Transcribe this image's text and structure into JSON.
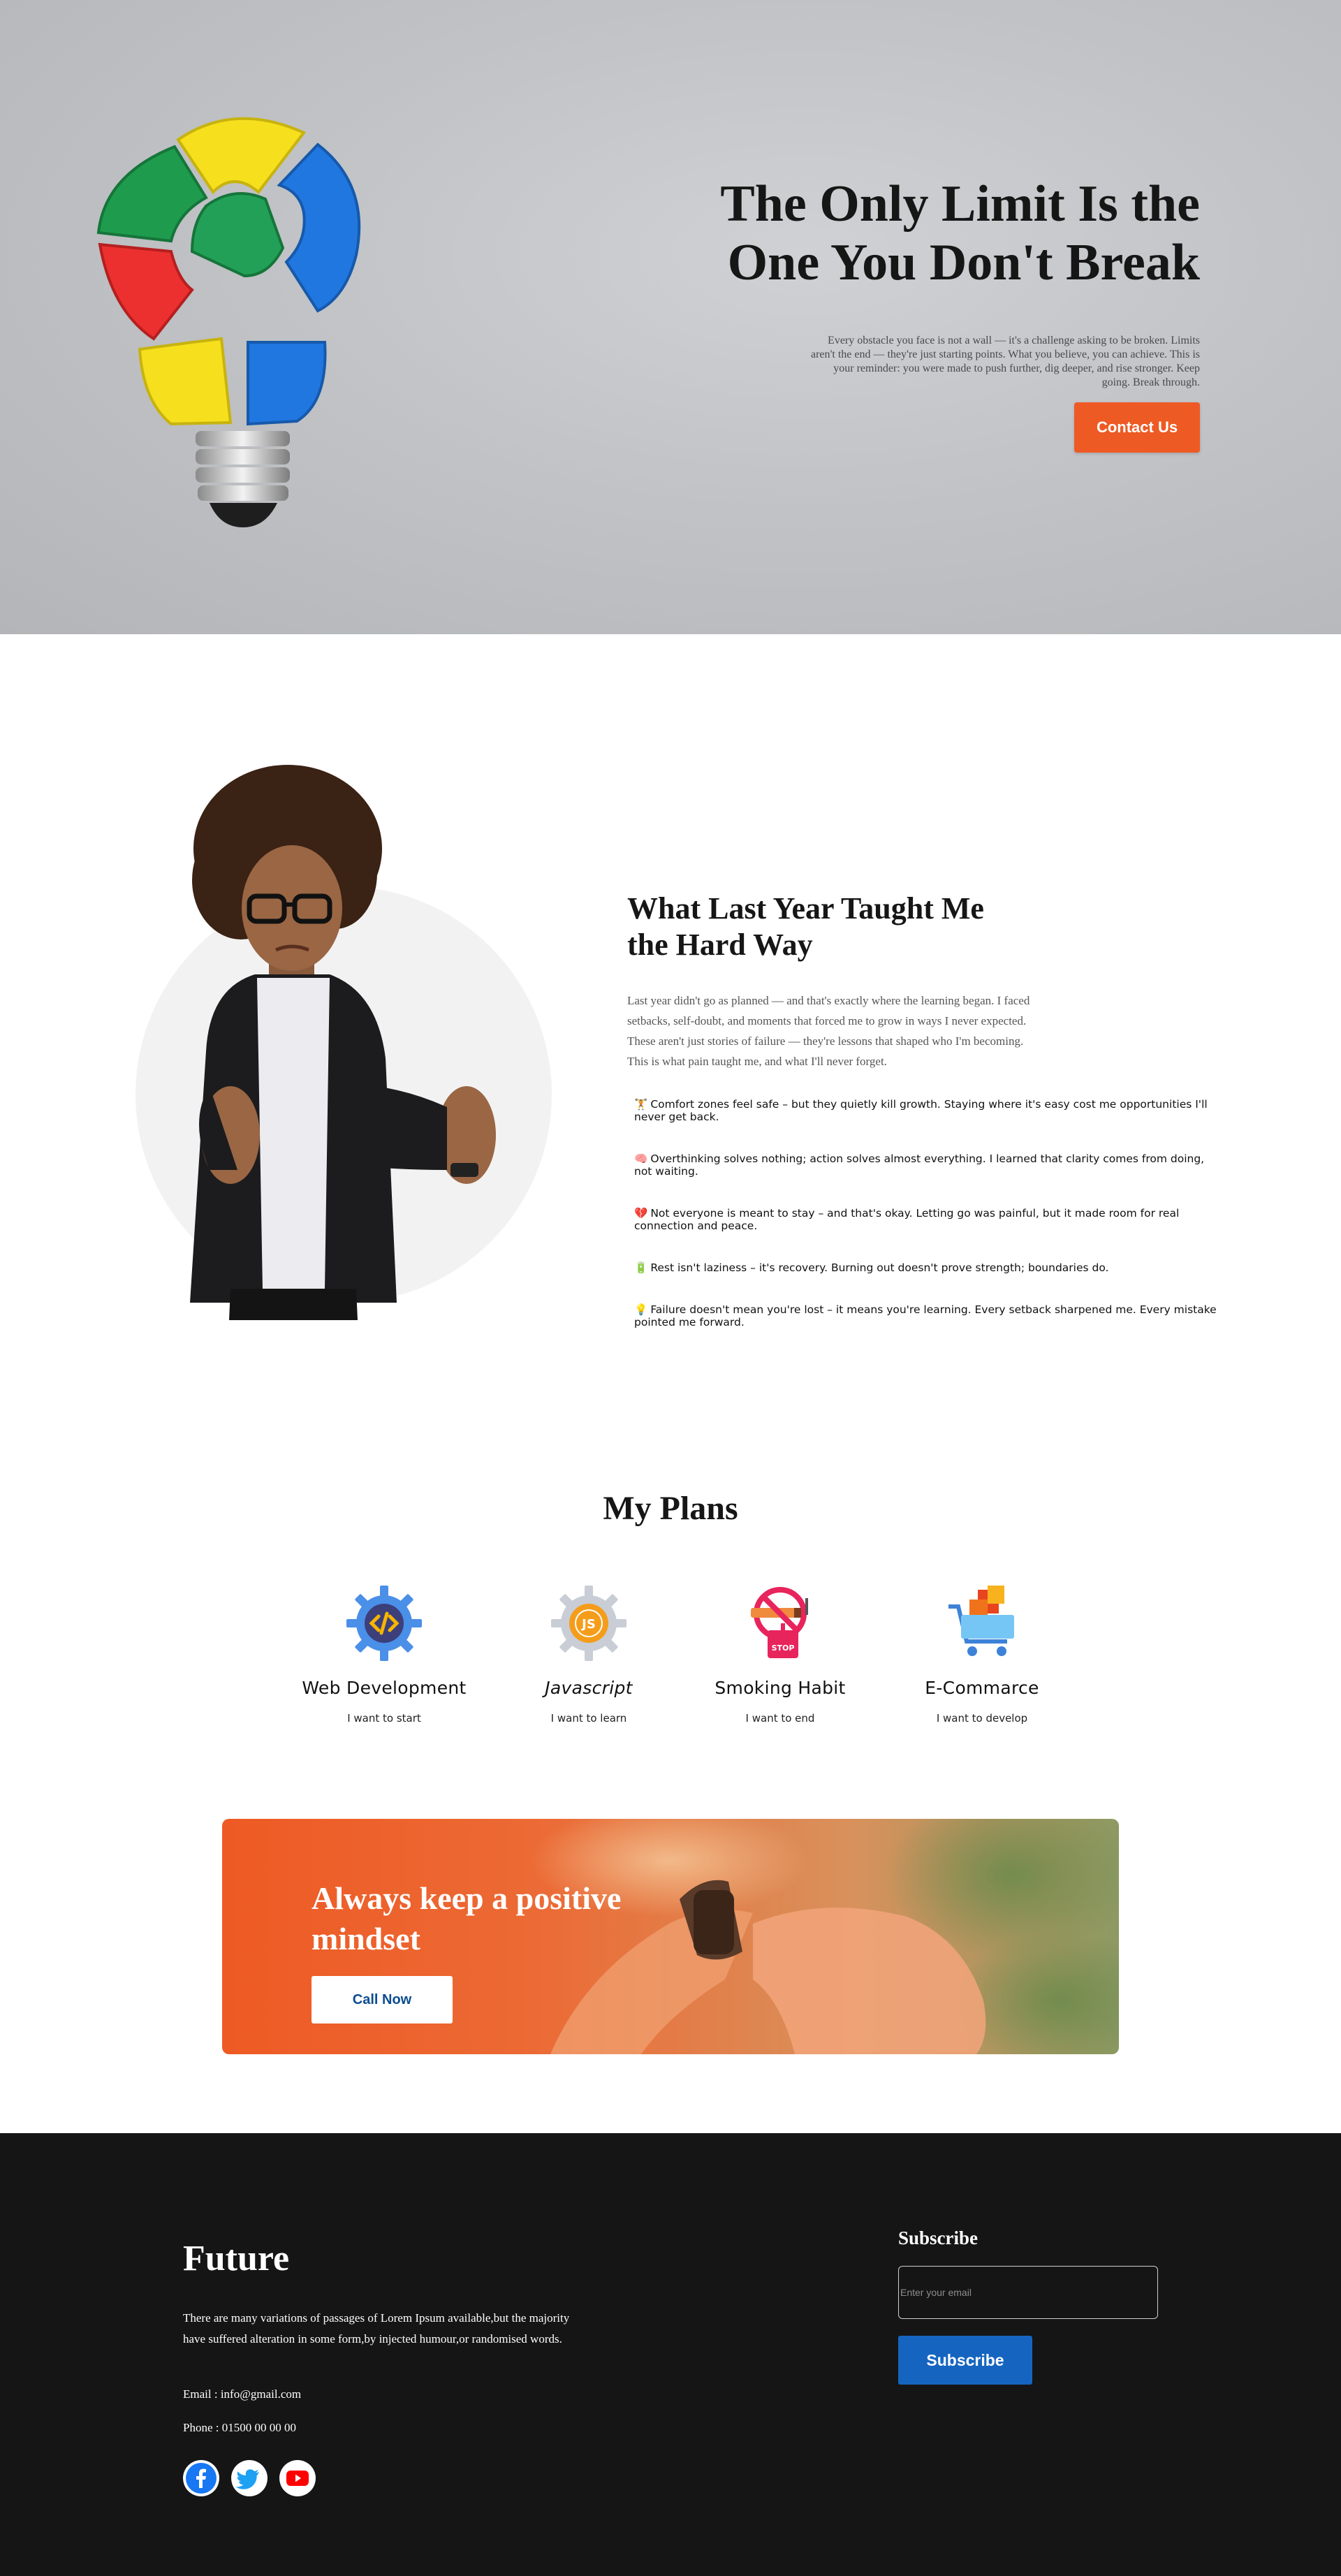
{
  "hero": {
    "title": "The Only Limit Is the One You Don't Break",
    "description": "Every obstacle you face is not a wall — it's a challenge asking to be broken. Limits aren't the end — they're just starting points. What you believe, you can achieve. This is your reminder: you were made to push further, dig deeper, and rise stronger. Keep going. Break through.",
    "contact_label": "Contact Us",
    "accent_color": "#ee5a24"
  },
  "lessons": {
    "title": "What Last Year Taught Me the Hard Way",
    "intro": "Last year didn't go as planned — and that's exactly where the learning began. I faced setbacks, self-doubt, and moments that forced me to grow in ways I never expected. These aren't just stories of failure — they're lessons that shaped who I'm becoming. This is what pain taught me, and what I'll never forget.",
    "items": [
      {
        "icon": "🏋️",
        "text": "Comfort zones feel safe – but they quietly kill growth. Staying where it's easy cost me opportunities I'll never get back."
      },
      {
        "icon": "🧠",
        "text": "Overthinking solves nothing; action solves almost everything. I learned that clarity comes from doing, not waiting."
      },
      {
        "icon": "💔",
        "text": "Not everyone is meant to stay – and that's okay. Letting go was painful, but it made room for real connection and peace."
      },
      {
        "icon": "🔋",
        "text": "Rest isn't laziness – it's recovery. Burning out doesn't prove strength; boundaries do."
      },
      {
        "icon": "💡",
        "text": "Failure doesn't mean you're lost – it means you're learning. Every setback sharpened me. Every mistake pointed me forward."
      }
    ]
  },
  "plans": {
    "title": "My Plans",
    "items": [
      {
        "name": "Web Development",
        "sub": "I want to start",
        "icon": "code-gear-icon"
      },
      {
        "name": "Javascript",
        "sub": "I want to learn",
        "icon": "js-gear-icon"
      },
      {
        "name": "Smoking Habit",
        "sub": "I want to end",
        "icon": "no-smoking-icon",
        "icon_text": "STOP"
      },
      {
        "name": "E-Commarce",
        "sub": "I want to develop",
        "icon": "shopping-cart-icon"
      }
    ]
  },
  "cta": {
    "text": "Always keep a positive mindset",
    "button_label": "Call Now"
  },
  "footer": {
    "brand": "Future",
    "description": "There are many variations of passages of Lorem Ipsum available,but the majority have suffered alteration in some form,by injected humour,or randomised words.",
    "email": "Email : info@gmail.com",
    "phone": "Phone : 01500 00 00 00",
    "socials": [
      "facebook-icon",
      "twitter-icon",
      "youtube-icon"
    ],
    "subscribe_title": "Subscribe",
    "email_placeholder": "Enter your email",
    "subscribe_label": "Subscribe",
    "button_color": "#1565c0"
  }
}
